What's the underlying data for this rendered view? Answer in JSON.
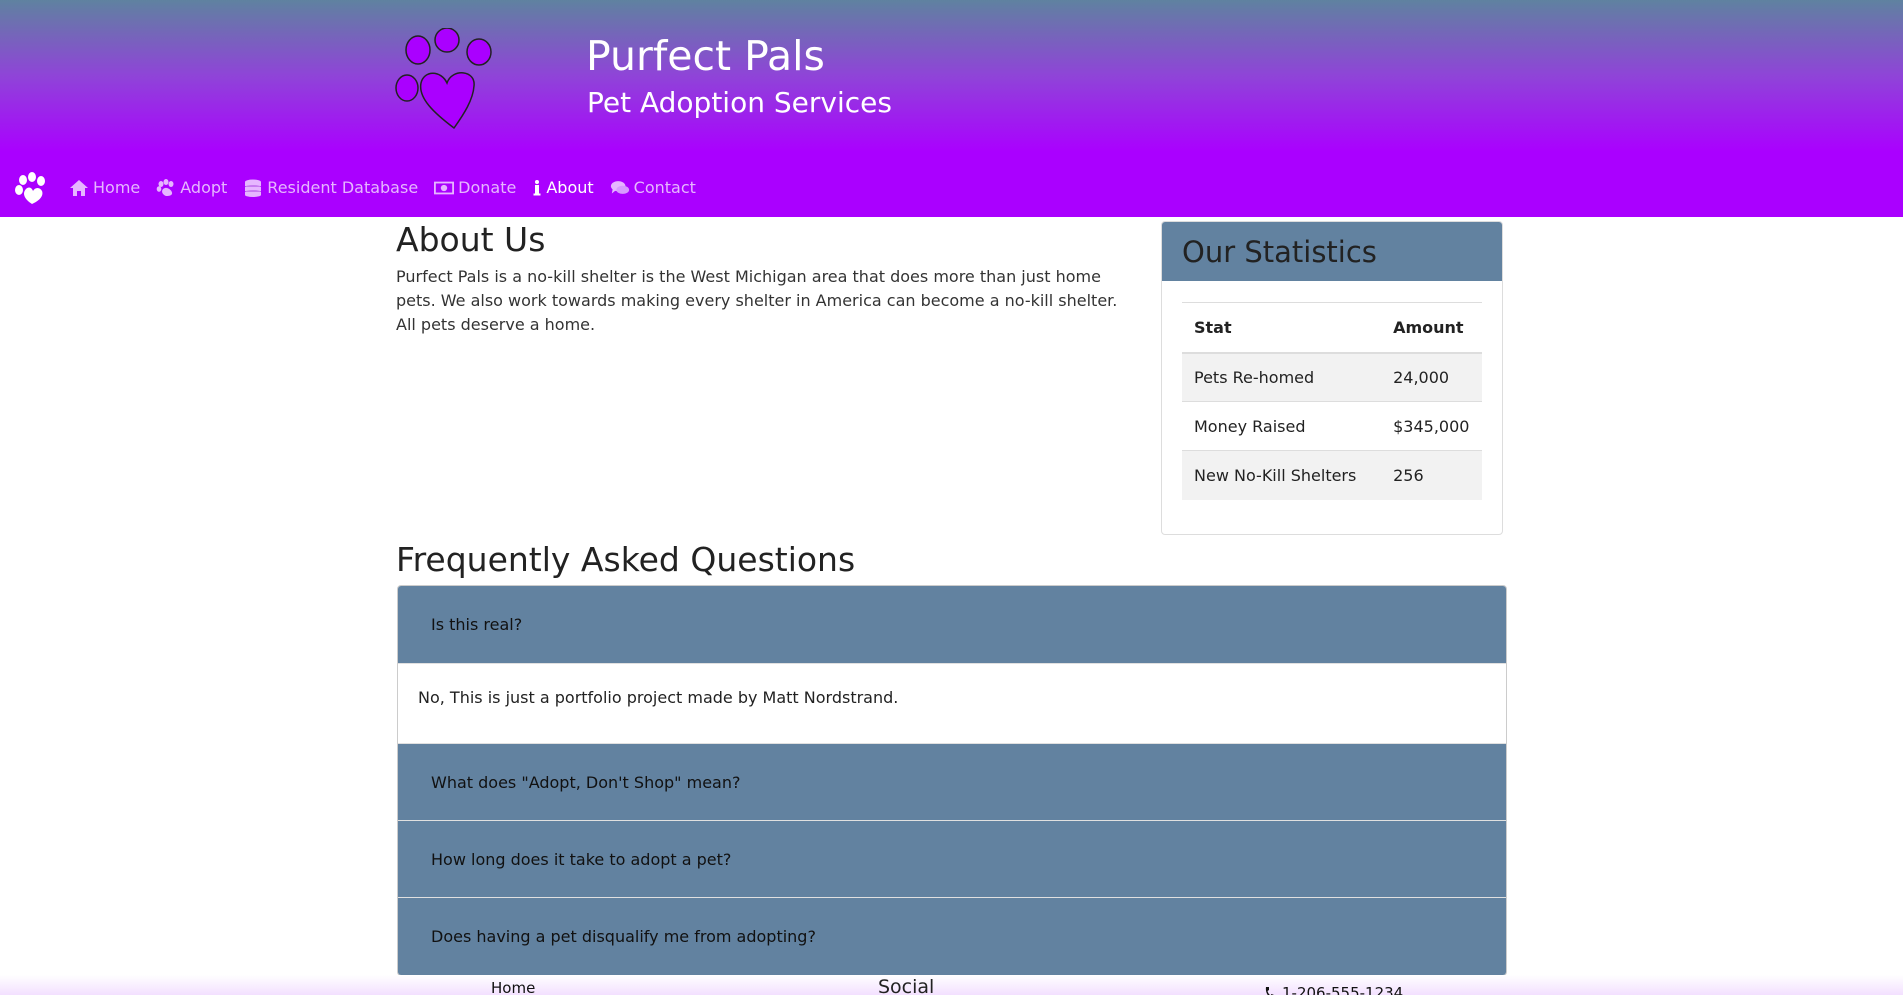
{
  "header": {
    "title": "Purfect Pals",
    "subtitle": "Pet Adoption Services",
    "logo_icon": "paw-heart-icon",
    "gradient_top": "#5f82a0",
    "gradient_bottom": "#aa00ff",
    "logo_fill": "#aa00ff"
  },
  "nav": {
    "brand_icon": "paw-icon",
    "items": [
      {
        "label": "Home",
        "icon": "home-icon",
        "active": false
      },
      {
        "label": "Adopt",
        "icon": "paw-icon",
        "active": false
      },
      {
        "label": "Resident Database",
        "icon": "database-icon",
        "active": false
      },
      {
        "label": "Donate",
        "icon": "money-icon",
        "active": false
      },
      {
        "label": "About",
        "icon": "info-icon",
        "active": true
      },
      {
        "label": "Contact",
        "icon": "comments-icon",
        "active": false
      }
    ]
  },
  "about": {
    "title": "About Us",
    "text": "Purfect Pals is a no-kill shelter is the West Michigan area that does more than just home pets. We also work towards making every shelter in America can become a no-kill shelter. All pets deserve a home."
  },
  "stats": {
    "title": "Our Statistics",
    "columns": [
      "Stat",
      "Amount"
    ],
    "rows": [
      [
        "Pets Re-homed",
        "24,000"
      ],
      [
        "Money Raised",
        "$345,000"
      ],
      [
        "New No-Kill Shelters",
        "256"
      ]
    ],
    "header_color": "#6282a0"
  },
  "faq": {
    "title": "Frequently Asked Questions",
    "items": [
      {
        "question": "Is this real?",
        "answer": "No, This is just a portfolio project made by Matt Nordstrand.",
        "expanded": true
      },
      {
        "question": "What does \"Adopt, Don't Shop\" mean?",
        "expanded": false
      },
      {
        "question": "How long does it take to adopt a pet?",
        "expanded": false
      },
      {
        "question": "Does having a pet disqualify me from adopting?",
        "expanded": false
      }
    ]
  },
  "footer": {
    "home_label": "Home",
    "social_label": "Social",
    "phone": "1-206-555-1234",
    "phone_icon": "phone-icon"
  }
}
